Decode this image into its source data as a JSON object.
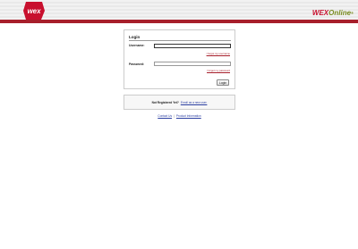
{
  "header": {
    "logo_left_text": "wex",
    "logo_right_brand": "WEX",
    "logo_right_suffix": "Online",
    "logo_right_mark": "®"
  },
  "login": {
    "title": "Login",
    "username_label": "Username:",
    "username_value": "",
    "forgot_username": "I forgot my username",
    "password_label": "Password:",
    "password_value": "",
    "forgot_password": "I forgot my password",
    "button_label": "Login"
  },
  "register": {
    "prompt": "Not Registered Yet?",
    "link": "Enroll as a new user."
  },
  "footer": {
    "contact": "Contact Us",
    "separator": "|",
    "product_info": "Product Information"
  },
  "colors": {
    "brand_red": "#a71f2b",
    "link_blue": "#2b3fa1",
    "online_green": "#7a8d22"
  }
}
